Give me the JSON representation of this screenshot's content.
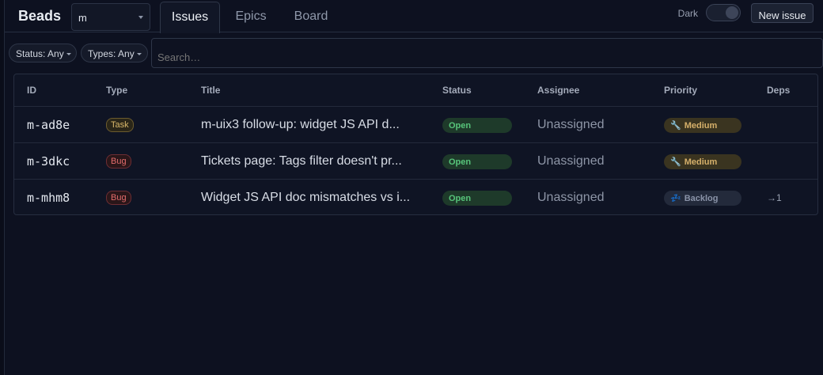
{
  "header": {
    "brand": "Beads",
    "workspace": "m",
    "tabs": [
      "Issues",
      "Epics",
      "Board"
    ],
    "active_tab": "Issues",
    "theme_label": "Dark",
    "new_issue_label": "New issue"
  },
  "filters": {
    "status_label": "Status: Any",
    "types_label": "Types: Any",
    "search_placeholder": "Search…"
  },
  "table": {
    "columns": [
      "ID",
      "Type",
      "Title",
      "Status",
      "Assignee",
      "Priority",
      "Deps"
    ],
    "rows": [
      {
        "id": "m-ad8e",
        "type": "Task",
        "title": "m-uix3 follow-up: widget JS API d...",
        "status": "Open",
        "assignee": "Unassigned",
        "priority": "Medium",
        "priority_icon": "wrench-icon",
        "deps": ""
      },
      {
        "id": "m-3dkc",
        "type": "Bug",
        "title": "Tickets page: Tags filter doesn't pr...",
        "status": "Open",
        "assignee": "Unassigned",
        "priority": "Medium",
        "priority_icon": "wrench-icon",
        "deps": ""
      },
      {
        "id": "m-mhm8",
        "type": "Bug",
        "title": "Widget JS API doc mismatches vs i...",
        "status": "Open",
        "assignee": "Unassigned",
        "priority": "Backlog",
        "priority_icon": "zzz-icon",
        "deps": "→1"
      }
    ]
  },
  "colors": {
    "background": "#0d1120",
    "status_open": "#57c47a",
    "task_badge": "#d9b86a",
    "bug_badge": "#e36c6c",
    "priority_medium": "#d6b06a",
    "priority_backlog": "#8a93a8"
  }
}
